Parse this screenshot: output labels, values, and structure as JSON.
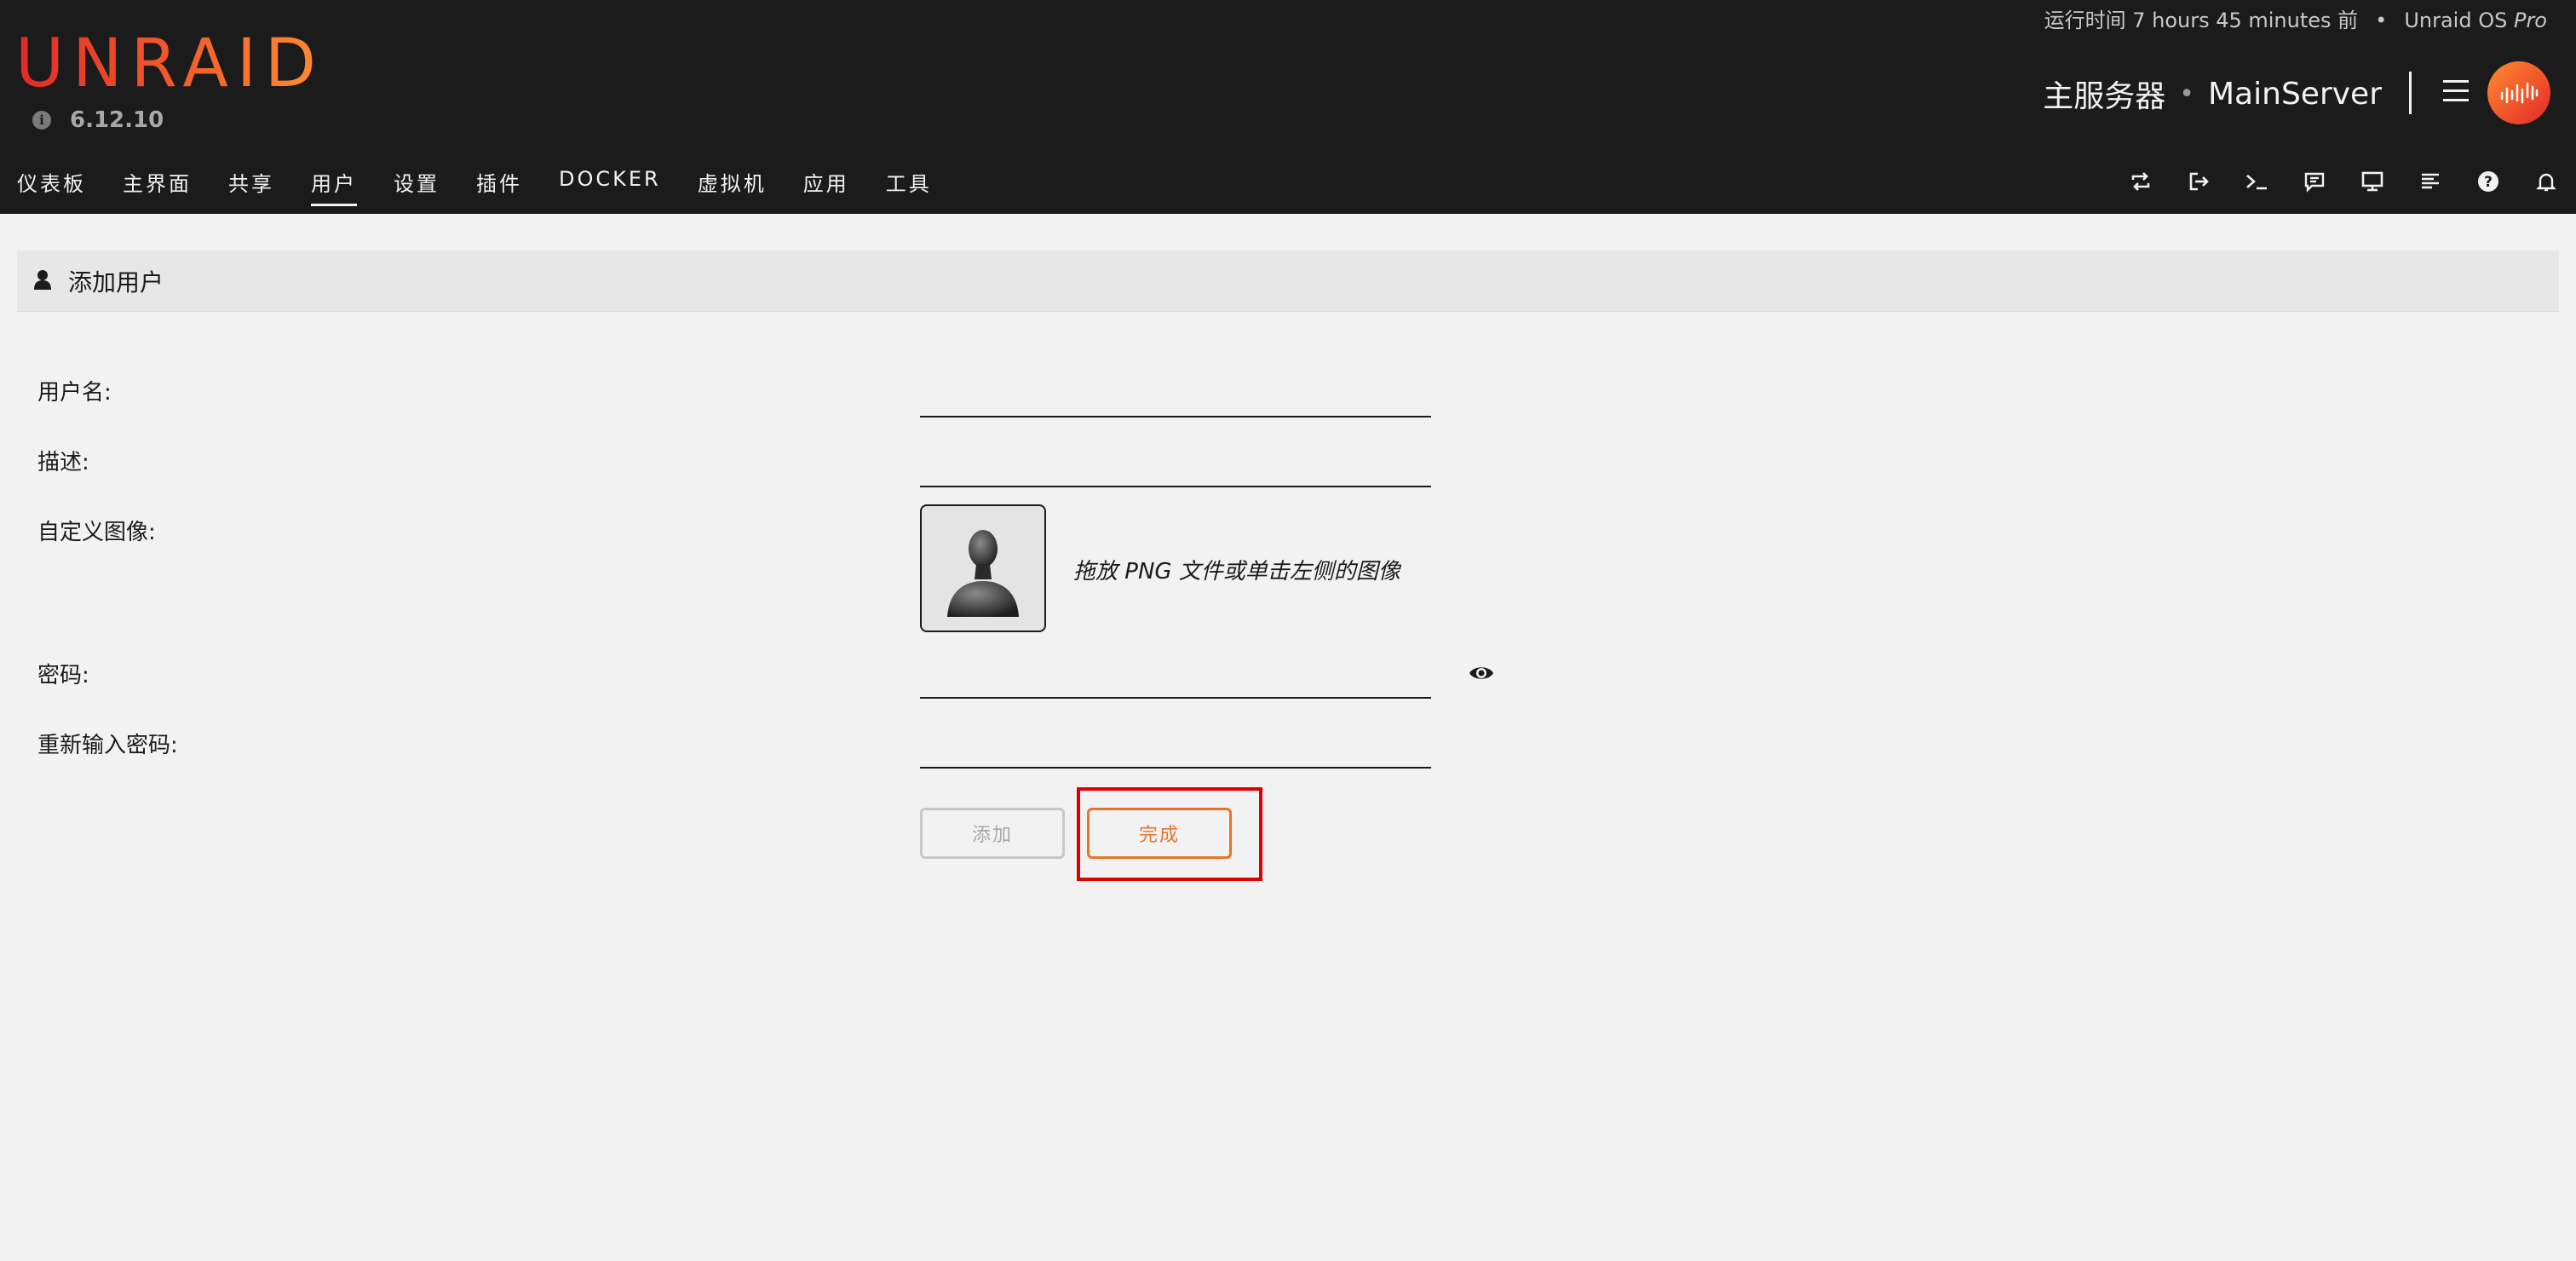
{
  "header": {
    "logo": "UNRAID",
    "version": "6.12.10",
    "uptime": "运行时间 7 hours 45 minutes 前",
    "separator": "•",
    "os_name": "Unraid OS",
    "os_edition": "Pro",
    "server_name": "主服务器",
    "server_dot": "•",
    "server_host": "MainServer"
  },
  "nav": {
    "items": [
      {
        "label": "仪表板"
      },
      {
        "label": "主界面"
      },
      {
        "label": "共享"
      },
      {
        "label": "用户",
        "active": true
      },
      {
        "label": "设置"
      },
      {
        "label": "插件"
      },
      {
        "label": "DOCKER"
      },
      {
        "label": "虚拟机"
      },
      {
        "label": "应用"
      },
      {
        "label": "工具"
      }
    ],
    "right_icons": [
      "switch-icon",
      "logout-icon",
      "terminal-icon",
      "feedback-icon",
      "monitor-icon",
      "log-icon",
      "help-icon",
      "bell-icon"
    ]
  },
  "page": {
    "title": "添加用户",
    "fields": {
      "username_label": "用户名:",
      "username_value": "",
      "description_label": "描述:",
      "description_value": "",
      "custom_image_label": "自定义图像:",
      "image_hint": "拖放 PNG 文件或单击左侧的图像",
      "password_label": "密码:",
      "password_value": "",
      "confirm_password_label": "重新输入密码:",
      "confirm_password_value": ""
    },
    "buttons": {
      "add_label": "添加",
      "add_disabled": true,
      "done_label": "完成"
    }
  },
  "colors": {
    "header_bg": "#1c1b1b",
    "brand_start": "#e22828",
    "brand_end": "#ff8c2f",
    "done_button": "#e8742c",
    "highlight": "#e00000",
    "page_bg": "#f2f2f2"
  }
}
